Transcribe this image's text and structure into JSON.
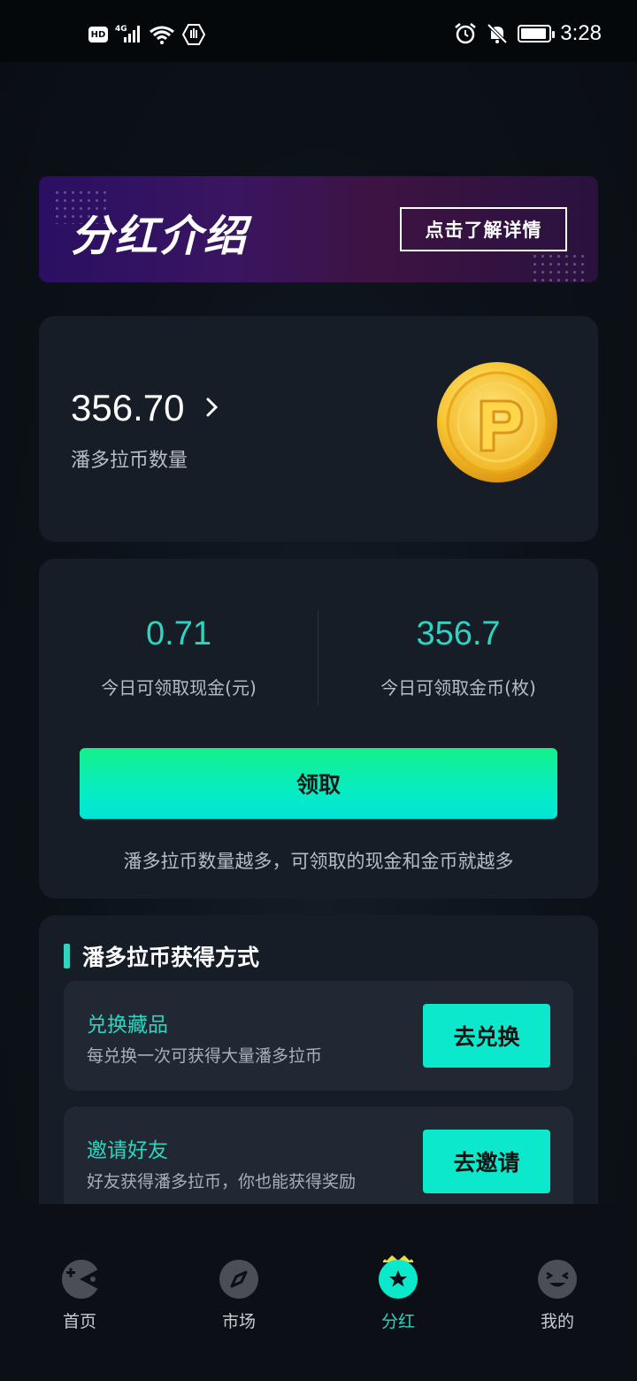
{
  "status_bar": {
    "time": "3:28",
    "network": "4G",
    "hd": "HD"
  },
  "banner": {
    "title": "分红介绍",
    "button": "点击了解详情"
  },
  "balance": {
    "value": "356.70",
    "label": "潘多拉币数量"
  },
  "claim": {
    "cash_value": "0.71",
    "cash_label": "今日可领取现金(元)",
    "coin_value": "356.7",
    "coin_label": "今日可领取金币(枚)",
    "button": "领取",
    "note": "潘多拉币数量越多，可领取的现金和金币就越多"
  },
  "ways": {
    "title": "潘多拉币获得方式",
    "items": [
      {
        "title": "兑换藏品",
        "desc": "每兑换一次可获得大量潘多拉币",
        "button": "去兑换"
      },
      {
        "title": "邀请好友",
        "desc": "好友获得潘多拉币，你也能获得奖励",
        "button": "去邀请"
      }
    ]
  },
  "nav": {
    "items": [
      {
        "label": "首页",
        "icon": "pacman-icon"
      },
      {
        "label": "市场",
        "icon": "compass-icon"
      },
      {
        "label": "分红",
        "icon": "crown-star-icon",
        "active": true
      },
      {
        "label": "我的",
        "icon": "smiley-icon"
      }
    ]
  },
  "colors": {
    "accent": "#2dd4bf",
    "background": "#0c1118",
    "card": "#171d27"
  }
}
